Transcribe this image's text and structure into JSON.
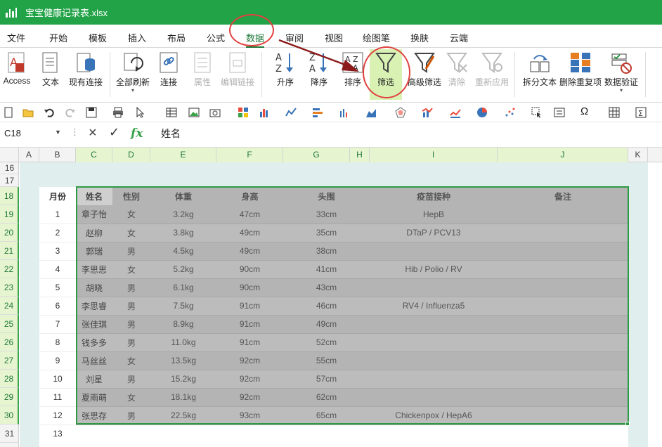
{
  "window": {
    "title": "宝宝健康记录表.xlsx"
  },
  "menu": {
    "tabs": [
      "文件",
      "开始",
      "模板",
      "插入",
      "布局",
      "公式",
      "数据",
      "审阅",
      "视图",
      "绘图笔",
      "换肤",
      "云端"
    ],
    "active_index": 6
  },
  "ribbon": {
    "access": "Access",
    "text": "文本",
    "existing_conn": "现有连接",
    "refresh_all": "全部刷新",
    "connect": "连接",
    "properties": "属性",
    "edit_links": "编辑链接",
    "sort_asc": "升序",
    "sort_desc": "降序",
    "sort": "排序",
    "filter": "筛选",
    "advanced_filter": "高级筛选",
    "clear": "清除",
    "reapply": "重新应用",
    "split_text": "拆分文本",
    "remove_duplicates": "删除重复项",
    "data_validation": "数据验证"
  },
  "formula_bar": {
    "name_box": "C18",
    "fx": "fx",
    "value": "姓名"
  },
  "grid": {
    "columns": [
      "A",
      "B",
      "C",
      "D",
      "E",
      "F",
      "G",
      "H",
      "I",
      "J",
      "K"
    ],
    "rows": [
      "16",
      "17",
      "18",
      "19",
      "20",
      "21",
      "22",
      "23",
      "24",
      "25",
      "26",
      "27",
      "28",
      "29",
      "30",
      "31"
    ]
  },
  "table": {
    "headers": [
      "月份",
      "姓名",
      "性别",
      "体重",
      "身高",
      "头围",
      "疫苗接种",
      "备注"
    ],
    "rows": [
      [
        "1",
        "章子怡",
        "女",
        "3.2kg",
        "47cm",
        "33cm",
        "HepB",
        ""
      ],
      [
        "2",
        "赵柳",
        "女",
        "3.8kg",
        "49cm",
        "35cm",
        "DTaP / PCV13",
        ""
      ],
      [
        "3",
        "郭瑞",
        "男",
        "4.5kg",
        "49cm",
        "38cm",
        "",
        ""
      ],
      [
        "4",
        "李思思",
        "女",
        "5.2kg",
        "90cm",
        "41cm",
        "Hib / Polio / RV",
        ""
      ],
      [
        "5",
        "胡晓",
        "男",
        "6.1kg",
        "90cm",
        "43cm",
        "",
        ""
      ],
      [
        "6",
        "李思睿",
        "男",
        "7.5kg",
        "91cm",
        "46cm",
        "RV4 / Influenza5",
        ""
      ],
      [
        "7",
        "张佳琪",
        "男",
        "8.9kg",
        "91cm",
        "49cm",
        "",
        ""
      ],
      [
        "8",
        "钱多多",
        "男",
        "11.0kg",
        "91cm",
        "52cm",
        "",
        ""
      ],
      [
        "9",
        "马丝丝",
        "女",
        "13.5kg",
        "92cm",
        "55cm",
        "",
        ""
      ],
      [
        "10",
        "刘星",
        "男",
        "15.2kg",
        "92cm",
        "57cm",
        "",
        ""
      ],
      [
        "11",
        "夏雨萌",
        "女",
        "18.1kg",
        "92cm",
        "62cm",
        "",
        ""
      ],
      [
        "12",
        "张思存",
        "男",
        "22.5kg",
        "93cm",
        "65cm",
        "Chickenpox / HepA6",
        ""
      ]
    ],
    "extra_month": "13"
  },
  "colors": {
    "titlebar": "#22a348",
    "accent": "#1f7a3a",
    "annotation": "#e0403e",
    "filter_highlight": "#d9f2b4"
  }
}
